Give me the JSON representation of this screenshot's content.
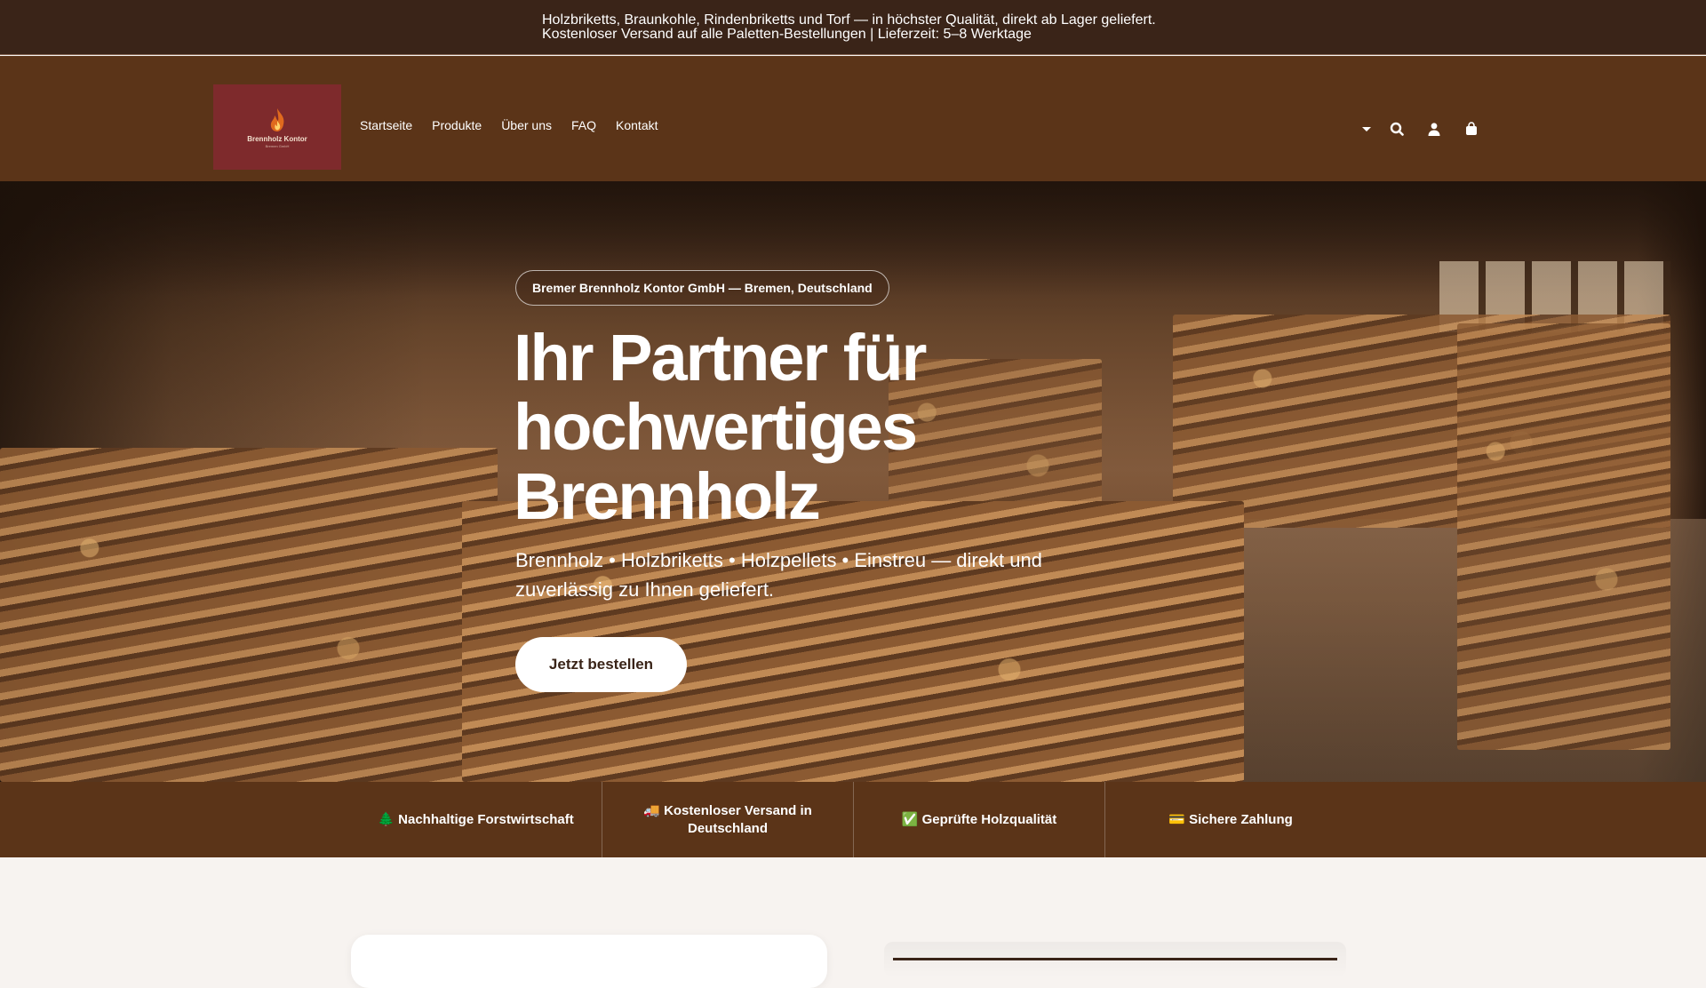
{
  "announcement": "Holzbriketts, Braunkohle, Rindenbriketts und Torf — in höchster Qualität, direkt ab Lager geliefert. Kostenloser Versand auf alle Paletten-Bestellungen | Lieferzeit: 5–8 Werktage",
  "logo": {
    "name": "Brennholz Kontor",
    "subtitle": "Bremen GmbH"
  },
  "nav": [
    "Startseite",
    "Produkte",
    "Über uns",
    "FAQ",
    "Kontakt"
  ],
  "header_icons": [
    "chevron-down-icon",
    "search-icon",
    "account-icon",
    "cart-icon"
  ],
  "hero": {
    "badge": "Bremer Brennholz Kontor GmbH — Bremen, Deutschland",
    "title": "Ihr Partner für hochwertiges Brennholz",
    "lead": "Brennholz • Holzbriketts • Holzpellets • Einstreu — direkt und zuverlässig zu Ihnen geliefert.",
    "cta": "Jetzt bestellen"
  },
  "features": [
    {
      "icon": "🌲",
      "text": "Nachhaltige Forstwirtschaft"
    },
    {
      "icon": "🚚",
      "text": "Kostenloser Versand in Deutschland"
    },
    {
      "icon": "✅",
      "text": "Geprüfte Holzqualität"
    },
    {
      "icon": "💳",
      "text": "Sichere Zahlung"
    }
  ],
  "colors": {
    "topbar": "#3a2418",
    "header": "#5b3418",
    "page_bg": "#f7f3f0",
    "logo_bg": "#7e2a2c"
  }
}
